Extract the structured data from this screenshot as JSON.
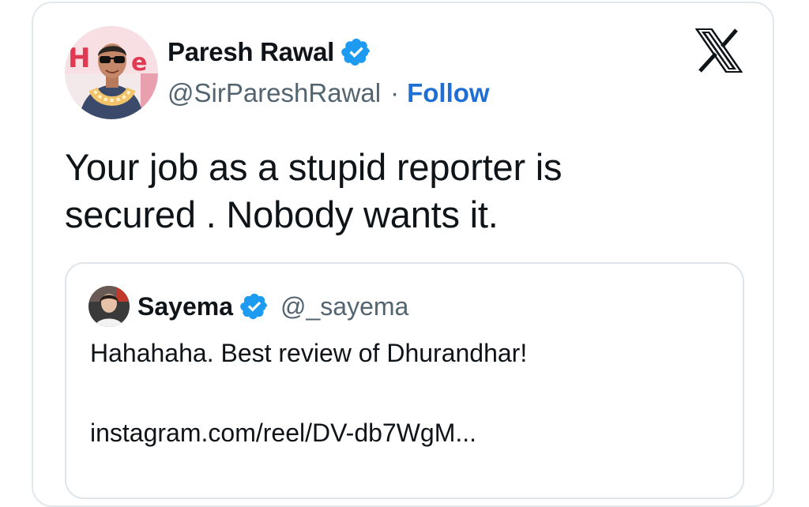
{
  "tweet": {
    "author_name": "Paresh Rawal",
    "author_handle": "@SirPareshRawal",
    "separator": "·",
    "follow_label": "Follow",
    "text_line1": "Your job as a stupid reporter is",
    "text_line2": "secured . Nobody wants it.",
    "verified_color": "#1d9bf0",
    "follow_color": "#1d6fd6"
  },
  "quoted_tweet": {
    "author_name": "Sayema",
    "author_handle": "@_sayema",
    "text": "Hahahaha. Best review of Dhurandhar!",
    "link_text": "instagram.com/reel/DV-db7WgM..."
  },
  "icons": {
    "platform_logo": "x-logo-icon",
    "verified": "verified-badge-icon"
  }
}
